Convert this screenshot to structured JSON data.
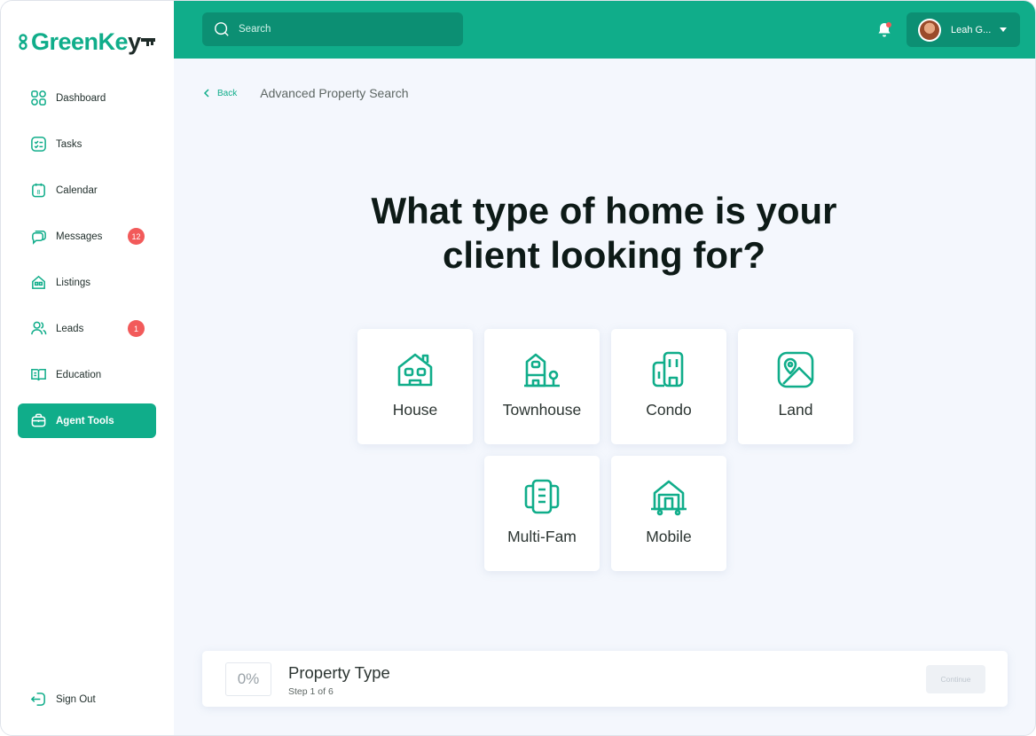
{
  "brand": {
    "name_prefix": "GreenKe",
    "name_suffix": "y",
    "accent": "#10ad8a",
    "dark": "#1e2b28"
  },
  "search": {
    "placeholder": "Search"
  },
  "user": {
    "name": "Leah G..."
  },
  "sidebar": {
    "items": [
      {
        "label": "Dashboard",
        "icon": "grid-icon"
      },
      {
        "label": "Tasks",
        "icon": "checklist-icon"
      },
      {
        "label": "Calendar",
        "icon": "calendar-icon"
      },
      {
        "label": "Messages",
        "icon": "chat-icon",
        "badge": "12"
      },
      {
        "label": "Listings",
        "icon": "house-icon"
      },
      {
        "label": "Leads",
        "icon": "people-icon",
        "badge": "1"
      },
      {
        "label": "Education",
        "icon": "book-icon"
      },
      {
        "label": "Agent Tools",
        "icon": "briefcase-icon",
        "active": true
      }
    ],
    "signout": "Sign Out"
  },
  "breadcrumb": {
    "back": "Back",
    "title": "Advanced Property Search"
  },
  "question": "What type of home is your client looking for?",
  "options": [
    {
      "label": "House",
      "icon": "house-icon"
    },
    {
      "label": "Townhouse",
      "icon": "townhouse-icon"
    },
    {
      "label": "Condo",
      "icon": "condo-building-icon"
    },
    {
      "label": "Land",
      "icon": "map-pin-icon"
    },
    {
      "label": "Multi-Fam",
      "icon": "multi-family-icon"
    },
    {
      "label": "Mobile",
      "icon": "mobile-home-icon"
    }
  ],
  "progress": {
    "percent_label": "0%",
    "percent": 0,
    "title": "Property Type",
    "step": "Step 1 of 6",
    "continue": "Continue"
  }
}
